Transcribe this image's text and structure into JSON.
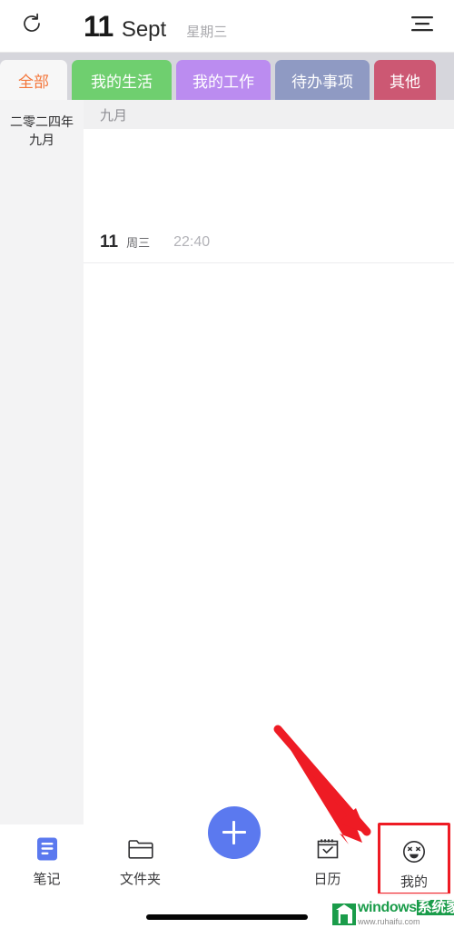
{
  "header": {
    "refresh_icon": "refresh-icon",
    "day": "11",
    "month": "Sept",
    "weekday": "星期三",
    "menu_icon": "hamburger-menu-icon"
  },
  "tabs": {
    "items": [
      {
        "label": "全部",
        "bg": "#f7f7f7",
        "fg": "#f4763a",
        "name": "tab-all"
      },
      {
        "label": "我的生活",
        "bg": "#6fcf6f",
        "fg": "#ffffff",
        "name": "tab-my-life"
      },
      {
        "label": "我的工作",
        "bg": "#bb8cf0",
        "fg": "#ffffff",
        "name": "tab-my-work"
      },
      {
        "label": "待办事项",
        "bg": "#8f9ac3",
        "fg": "#ffffff",
        "name": "tab-todo"
      },
      {
        "label": "其他",
        "bg": "#cc5873",
        "fg": "#ffffff",
        "name": "tab-other"
      }
    ],
    "strip_bg": "#d6d6dc"
  },
  "sidebar": {
    "month_line1": "二零二四年",
    "month_line2": "九月",
    "bg": "#f3f3f4"
  },
  "content": {
    "month_bar_label": "九月",
    "entries": [
      {
        "day": "11",
        "weekday": "周三",
        "time": "22:40"
      }
    ]
  },
  "bottom_nav": {
    "items": [
      {
        "label": "笔记",
        "icon": "notes-icon",
        "name": "nav-item-notes",
        "active": true
      },
      {
        "label": "文件夹",
        "icon": "folder-icon",
        "name": "nav-item-folder",
        "active": false
      },
      {
        "label": "日历",
        "icon": "calendar-icon",
        "name": "nav-item-calendar",
        "active": false
      },
      {
        "label": "我的",
        "icon": "profile-face-icon",
        "name": "nav-item-profile",
        "active": false
      }
    ],
    "fab": {
      "icon": "plus-icon",
      "color": "#5b79ef",
      "name": "add-note-fab"
    },
    "active_color": "#5b79ef",
    "highlight_color": "#ee1b24"
  },
  "annotation": {
    "arrow_color": "#ee1b24",
    "arrow_target": "nav-item-profile",
    "highlight_box_target": "nav-item-profile"
  },
  "watermark": {
    "brand_en": "windows",
    "brand_cn": "系统家园",
    "url": "www.ruhaifu.com",
    "color": "#1a9c4a"
  }
}
